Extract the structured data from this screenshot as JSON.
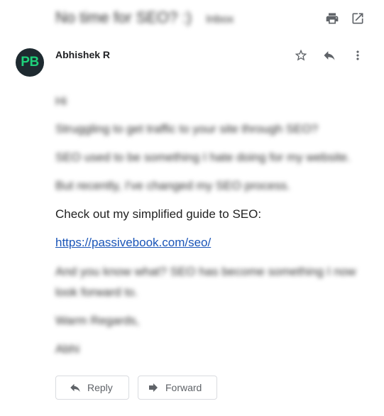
{
  "header": {
    "subject": "No time for SEO? :)",
    "subject_label": "Inbox",
    "print_icon": "print-icon",
    "open_new_window_icon": "open-in-new-window-icon"
  },
  "message": {
    "sender_initials": "PB",
    "sender_name": "Abhishek R",
    "avatar_color": "#1e2a30",
    "avatar_text_color": "#1ed07a",
    "actions": [
      "star-icon",
      "reply-icon",
      "more-options-icon"
    ],
    "body": {
      "greeting": "Hi",
      "line1": "Struggling to get traffic to your site through SEO?",
      "line2": "SEO used to be something I hate doing for my website.",
      "line3": "But recently, I've changed my SEO process.",
      "guide_text": "Check out my simplified guide to SEO:",
      "link_text": "https://passivebook.com/seo/",
      "para_line1": "And you know what? SEO has become something I now",
      "para_line2": "look forward to.",
      "signoff": "Warm Regards,",
      "signature": "Abhi"
    }
  },
  "footer": {
    "reply_label": "Reply",
    "forward_label": "Forward"
  },
  "colors": {
    "link": "#1a55b8",
    "button_border": "#dadce0",
    "icon": "#5f6368"
  }
}
